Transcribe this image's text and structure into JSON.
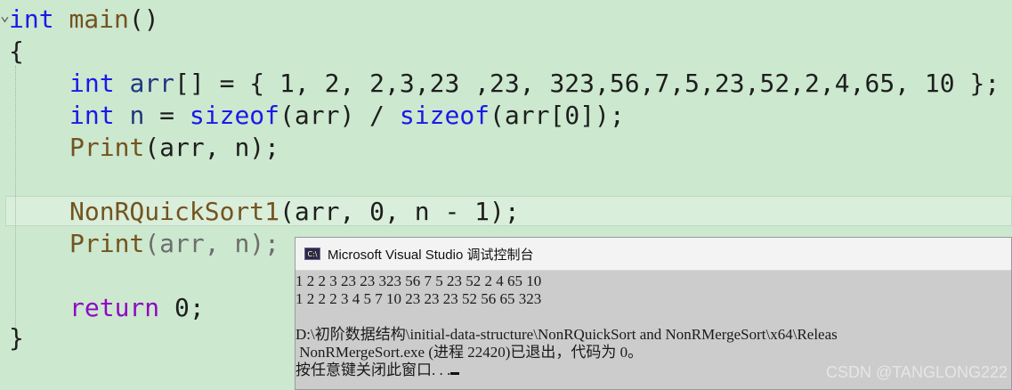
{
  "code": {
    "line1": {
      "type": "int",
      "name": "main",
      "parens": "()"
    },
    "line2": "{",
    "line3": {
      "type": "int",
      "var": "arr",
      "rest": "[] = { 1, 2, 2,3,23 ,23, 323,56,7,5,23,52,2,4,65, 10 };"
    },
    "line4": {
      "type": "int",
      "var": "n",
      "eq": " = ",
      "op1": "sizeof",
      "a1": "(arr) / ",
      "op2": "sizeof",
      "a2": "(arr[0]);"
    },
    "line5": {
      "fn": "Print",
      "args": "(arr, n);"
    },
    "line7": {
      "fn": "NonRQuickSort1",
      "args": "(arr, 0, n - 1);"
    },
    "line8": {
      "fn": "Print",
      "args": "(arr, n);"
    },
    "line10": {
      "kw": "return",
      "val": " 0;"
    },
    "line11": "}"
  },
  "console": {
    "title": "Microsoft Visual Studio 调试控制台",
    "icon": "console-app-icon",
    "lines": [
      "1 2 2 3 23 23 323 56 7 5 23 52 2 4 65 10",
      "1 2 2 2 3 4 5 7 10 23 23 23 52 56 65 323",
      "",
      "D:\\初阶数据结构\\initial-data-structure\\NonRQuickSort and NonRMergeSort\\x64\\Releas",
      " NonRMergeSort.exe (进程 22420)已退出，代码为 0。",
      "按任意键关闭此窗口. . ."
    ]
  },
  "watermark": "CSDN @TANGLONG222"
}
